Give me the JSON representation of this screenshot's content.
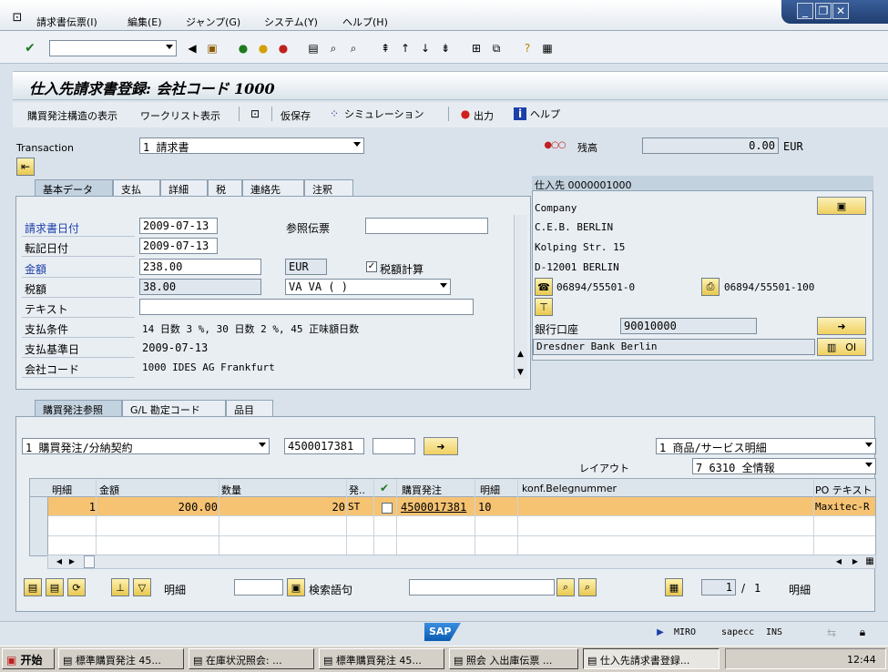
{
  "menu": {
    "items": [
      "請求書伝票(I)",
      "編集(E)",
      "ジャンプ(G)",
      "システム(Y)",
      "ヘルプ(H)"
    ]
  },
  "title": "仕入先請求書登録: 会社コード 1000",
  "app_toolbar": {
    "btn1": "購買発注構造の表示",
    "btn2": "ワークリスト表示",
    "btn3": "仮保存",
    "btn4": "シミュレーション",
    "btn5": "出力",
    "btn6": "ヘルプ"
  },
  "transaction": {
    "label": "Transaction",
    "value": "1 請求書"
  },
  "balance": {
    "label": "残高",
    "value": "0.00",
    "currency": "EUR"
  },
  "tabs_top": [
    "基本データ",
    "支払",
    "詳細",
    "税",
    "連絡先",
    "注釈"
  ],
  "basic": {
    "invoice_date_label": "請求書日付",
    "invoice_date": "2009-07-13",
    "reference_label": "参照伝票",
    "reference": "",
    "posting_date_label": "転記日付",
    "posting_date": "2009-07-13",
    "amount_label": "金額",
    "amount": "238.00",
    "amount_currency": "EUR",
    "calc_tax_label": "税額計算",
    "tax_label": "税額",
    "tax": "38.00",
    "tax_code": "VA VA ( )",
    "text_label": "テキスト",
    "text": "",
    "payment_terms_label": "支払条件",
    "payment_terms": "14 日数 3 %, 30 日数 2 %, 45 正味額日数",
    "baseline_label": "支払基準日",
    "baseline": "2009-07-13",
    "company_label": "会社コード",
    "company": "1000 IDES AG Frankfurt"
  },
  "vendor": {
    "header": "仕入先 0000001000",
    "lines": [
      "Company",
      "C.E.B. BERLIN",
      "Kolping Str. 15",
      "D-12001 BERLIN"
    ],
    "phone": "06894/55501-0",
    "fax": "06894/55501-100",
    "bank_label": "銀行口座",
    "bank_account": "90010000",
    "bank_name": "Dresdner Bank Berlin",
    "oi_label": "OI"
  },
  "tabs_bottom": [
    "購買発注参照",
    "G/L 勘定コード",
    "品目"
  ],
  "po_ref": {
    "type": "1 購買発注/分納契約",
    "po_number": "4500017381",
    "extra": "",
    "layout_type": "1 商品/サービス明細",
    "layout_label": "レイアウト",
    "layout": "7_6310 全情報"
  },
  "table": {
    "headers": [
      "明細",
      "金額",
      "数量",
      "発..",
      "",
      "購買発注",
      "明細",
      "konf.Belegnummer",
      "PO テキスト"
    ],
    "row": {
      "item": "1",
      "amount": "200.00",
      "qty": "20",
      "unit": "ST",
      "po": "4500017381",
      "po_item": "10",
      "konf": "",
      "po_text": "Maxitec-R"
    }
  },
  "bottom_bar": {
    "item_label": "明細",
    "search_label": "検索語句",
    "page_current": "1",
    "page_total": "1",
    "page_label": "明細"
  },
  "status": {
    "logo": "SAP",
    "system": "MIRO",
    "server": "sapecc",
    "mode": "INS"
  },
  "taskbar": {
    "start": "开始",
    "items": [
      "標準購買発注 45...",
      "在庫状況照会: ...",
      "標準購買発注 45...",
      "照会 入出庫伝票 ...",
      "仕入先請求書登録..."
    ],
    "clock": "12:44"
  }
}
